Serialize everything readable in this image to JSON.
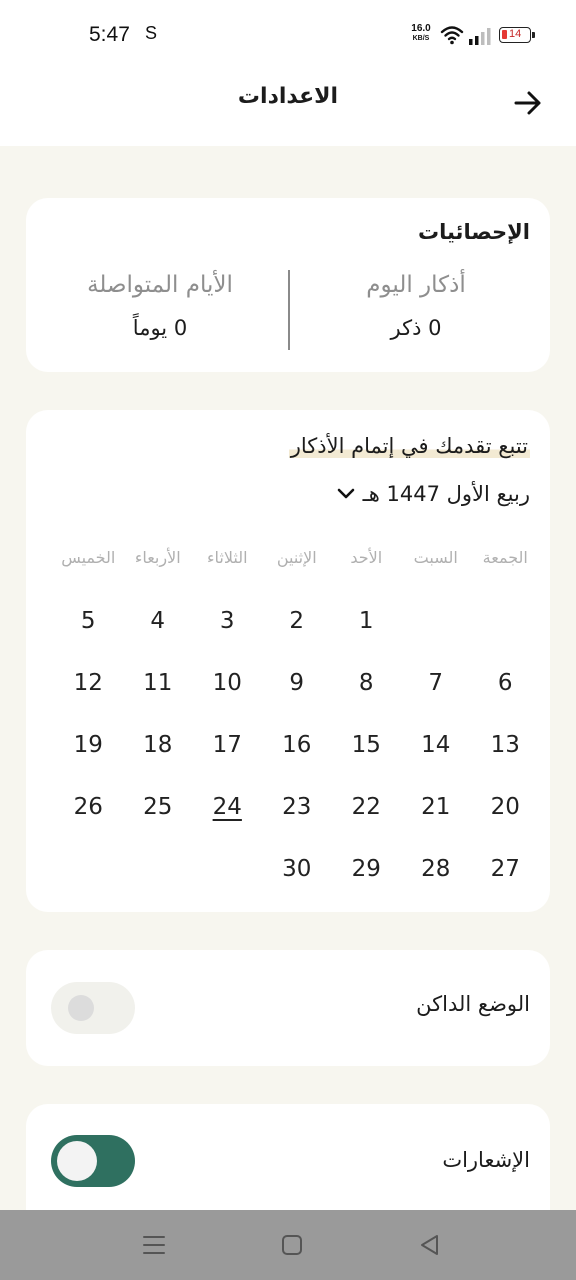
{
  "status": {
    "time": "5:47",
    "sync_glyph": "S",
    "net_speed_value": "16.0",
    "net_speed_unit": "KB/S",
    "battery": "14"
  },
  "header": {
    "title": "الاعدادات",
    "back_icon": "arrow-right-icon"
  },
  "stats": {
    "title": "الإحصائيات",
    "today_label": "أذكار اليوم",
    "today_value": "0 ذكر",
    "streak_label": "الأيام المتواصلة",
    "streak_value": "0 يوماً"
  },
  "calendar": {
    "title": "تتبع تقدمك في إتمام الأذكار",
    "month": "ربيع الأول 1447 هـ",
    "weekdays": [
      "الجمعة",
      "السبت",
      "الأحد",
      "الإثنين",
      "الثلاثاء",
      "الأربعاء",
      "الخميس"
    ],
    "weeks": [
      [
        "",
        "",
        "1",
        "2",
        "3",
        "4",
        "5"
      ],
      [
        "6",
        "7",
        "8",
        "9",
        "10",
        "11",
        "12"
      ],
      [
        "13",
        "14",
        "15",
        "16",
        "17",
        "18",
        "19"
      ],
      [
        "20",
        "21",
        "22",
        "23",
        "24",
        "25",
        "26"
      ],
      [
        "27",
        "28",
        "29",
        "30",
        "",
        "",
        ""
      ]
    ],
    "today": "24"
  },
  "settings": {
    "dark_mode_label": "الوضع الداكن",
    "dark_mode_on": false,
    "notifications_label": "الإشعارات",
    "notifications_on": true
  },
  "colors": {
    "accent": "#2f7060",
    "background": "#f7f6ef",
    "highlight": "#f3ead3"
  }
}
